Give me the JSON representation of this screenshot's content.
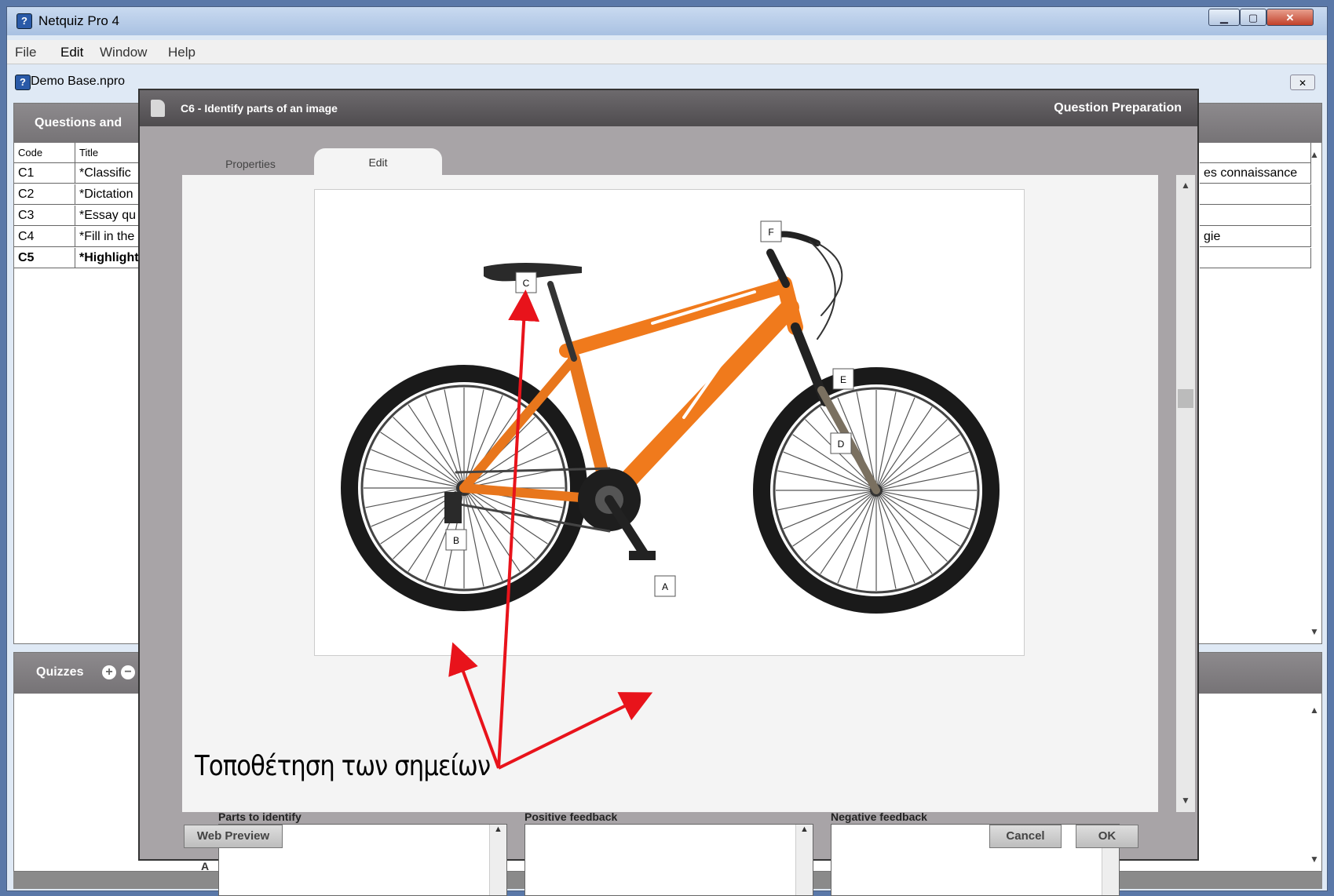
{
  "window": {
    "title": "Netquiz Pro 4"
  },
  "menu": [
    "File",
    "Edit",
    "Window",
    "Help"
  ],
  "document": {
    "title": "Demo Base.npro"
  },
  "questions_panel": {
    "header": "Questions and",
    "columns": [
      "Code",
      "Title"
    ],
    "rows": [
      {
        "code": "C1",
        "title": "*Classific",
        "extra": "es connaissance"
      },
      {
        "code": "C2",
        "title": "*Dictation",
        "extra": ""
      },
      {
        "code": "C3",
        "title": "*Essay qu",
        "extra": ""
      },
      {
        "code": "C4",
        "title": "*Fill in the",
        "extra": "gie"
      },
      {
        "code": "C5",
        "title": "*Highlight",
        "extra": ""
      }
    ]
  },
  "quizzes_panel": {
    "header": "Quizzes"
  },
  "dialog": {
    "title": "C6 - Identify parts of an image",
    "mode": "Question Preparation",
    "tabs": [
      "Properties",
      "Edit"
    ],
    "markers": [
      "A",
      "B",
      "C",
      "D",
      "E",
      "F"
    ],
    "annotation": "Τοποθέτηση των σημείων",
    "fields": {
      "parts_label": "Parts to identify",
      "positive_label": "Positive feedback",
      "negative_label": "Negative feedback",
      "row_label": "A"
    },
    "buttons": {
      "preview": "Web Preview",
      "cancel": "Cancel",
      "ok": "OK"
    }
  },
  "colors": {
    "bike_orange": "#f07a1c",
    "arrow_red": "#e8131b",
    "dialog_gray": "#a8a4a7"
  }
}
